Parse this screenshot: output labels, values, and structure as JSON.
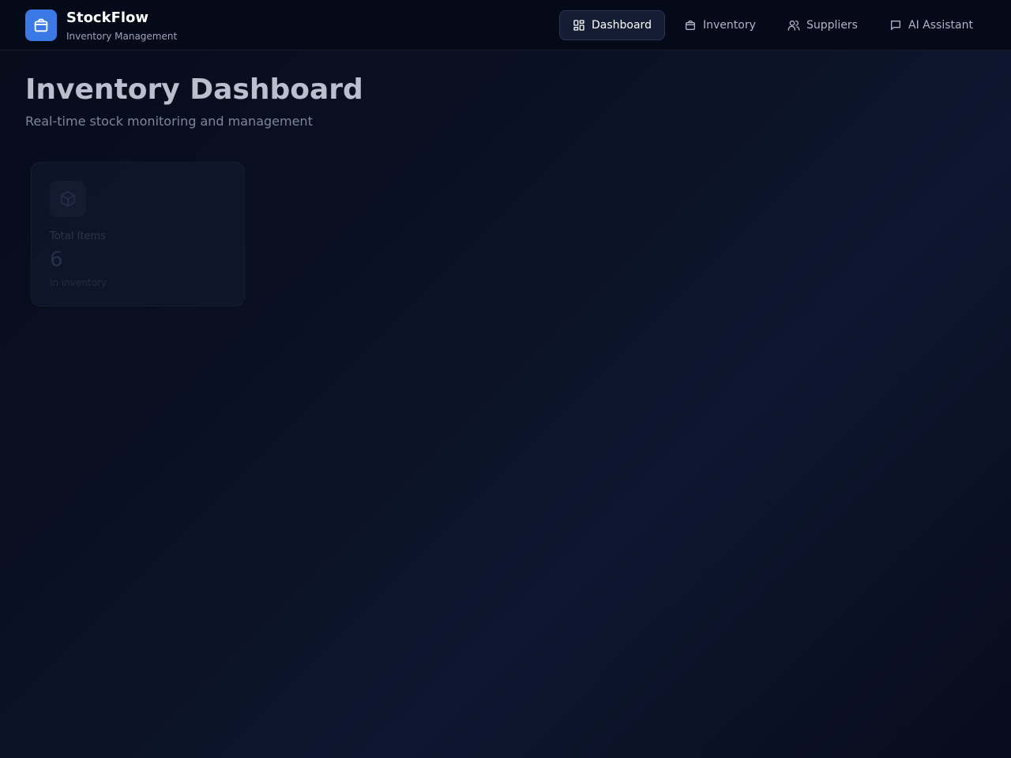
{
  "header": {
    "brand_title": "StockFlow",
    "brand_subtitle": "Inventory Management",
    "logo_icon": "package-icon",
    "accent_color": "#3b7ae6",
    "nav": [
      {
        "label": "Dashboard",
        "icon": "dashboard-grid-icon",
        "active": true
      },
      {
        "label": "Inventory",
        "icon": "package-icon",
        "active": false
      },
      {
        "label": "Suppliers",
        "icon": "users-icon",
        "active": false
      },
      {
        "label": "AI Assistant",
        "icon": "chat-bubble-icon",
        "active": false
      }
    ]
  },
  "main": {
    "title": "Inventory Dashboard",
    "subtitle": "Real-time stock monitoring and management",
    "stats": [
      {
        "icon": "cube-icon",
        "label": "Total Items",
        "value": "6",
        "caption": "In inventory"
      }
    ]
  }
}
